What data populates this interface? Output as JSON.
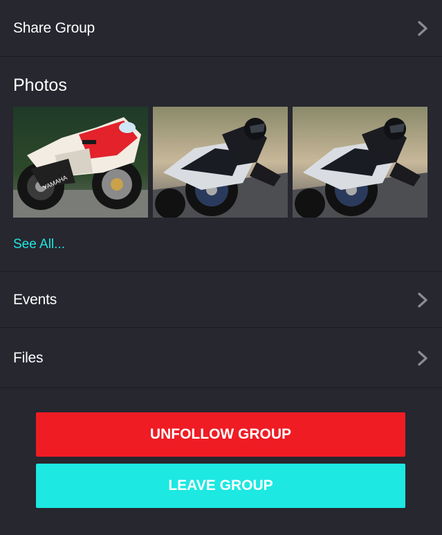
{
  "share_group": {
    "label": "Share Group",
    "icon": "chevron-right-icon"
  },
  "photos": {
    "title": "Photos",
    "items": [
      {
        "alt": "Yamaha red and white sport motorcycle"
      },
      {
        "alt": "Rider leaning black sport motorcycle in a turn"
      },
      {
        "alt": "Rider leaning black sport motorcycle in a turn"
      }
    ],
    "see_all": "See All..."
  },
  "events": {
    "label": "Events",
    "icon": "chevron-right-icon"
  },
  "files": {
    "label": "Files",
    "icon": "chevron-right-icon"
  },
  "actions": {
    "unfollow_label": "UNFOLLOW GROUP",
    "leave_label": "LEAVE GROUP"
  },
  "colors": {
    "background": "#272730",
    "accent_cyan": "#1de8e2",
    "danger_red": "#ef1c24",
    "chevron": "#8a8a92"
  }
}
